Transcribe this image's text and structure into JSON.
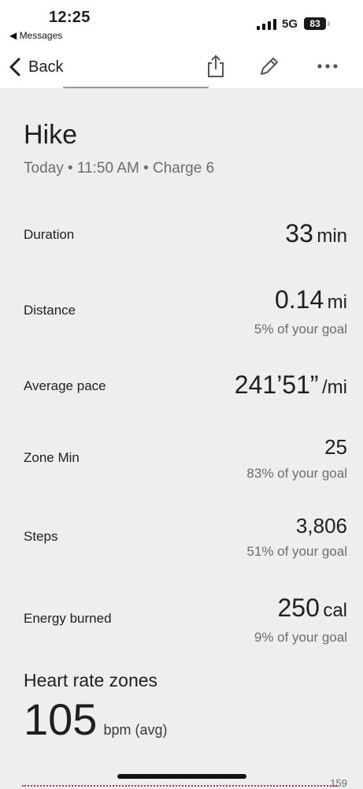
{
  "status_bar": {
    "time": "12:25",
    "back_app": "◀ Messages",
    "network": "5G",
    "battery": "83"
  },
  "nav": {
    "back_label": "Back",
    "icons": [
      "share-icon",
      "edit-icon",
      "more-icon"
    ]
  },
  "activity": {
    "title": "Hike",
    "subtitle": "Today • 11:50 AM • Charge 6"
  },
  "stats": {
    "duration": {
      "label": "Duration",
      "value": "33",
      "unit": "min"
    },
    "distance": {
      "label": "Distance",
      "value": "0.14",
      "unit": "mi",
      "goal": "5% of your goal"
    },
    "pace": {
      "label": "Average pace",
      "value": "241’51”",
      "unit": "/mi"
    },
    "zone_min": {
      "label": "Zone Min",
      "value": "25",
      "goal": "83% of your goal"
    },
    "steps": {
      "label": "Steps",
      "value": "3,806",
      "goal": "51% of your goal"
    },
    "energy": {
      "label": "Energy burned",
      "value": "250",
      "unit": "cal",
      "goal": "9% of your goal"
    }
  },
  "heart_rate": {
    "title": "Heart rate zones",
    "avg": "105",
    "unit": "bpm (avg)",
    "chart_max": "159"
  },
  "colors": {
    "background": "#eeeeec",
    "hr_line": "#d0246a"
  }
}
